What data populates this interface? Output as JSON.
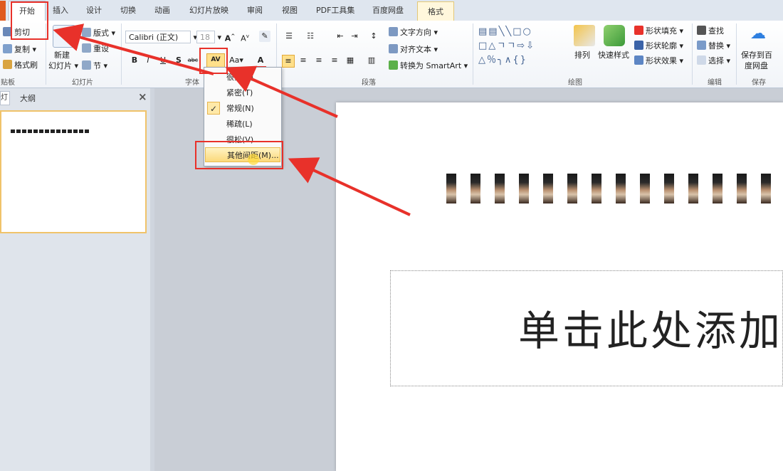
{
  "tabs": [
    "开始",
    "插入",
    "设计",
    "切换",
    "动画",
    "幻灯片放映",
    "审阅",
    "视图",
    "PDF工具集",
    "百度网盘",
    "格式"
  ],
  "clipboard": {
    "cut": "剪切",
    "copy": "复制",
    "format_painter": "格式刷",
    "label": "贴板"
  },
  "slides_group": {
    "new_slide_line1": "新建",
    "new_slide_line2": "幻灯片",
    "layout": "版式",
    "reset": "重设",
    "section": "节",
    "label": "幻灯片"
  },
  "font_group": {
    "font_name": "Calibri (正文)",
    "font_size": "18",
    "bold": "B",
    "italic": "I",
    "underline": "U",
    "strike": "abc",
    "shadow": "S",
    "spacing": "AV",
    "case": "Aa",
    "color": "A",
    "label": "字体"
  },
  "paragraph_group": {
    "text_direction": "文字方向",
    "align_text": "对齐文本",
    "smartart": "转换为 SmartArt",
    "label": "段落"
  },
  "drawing_group": {
    "arrange": "排列",
    "quick_styles": "快速样式",
    "fill": "形状填充",
    "outline": "形状轮廓",
    "effects": "形状效果",
    "label": "绘图"
  },
  "editing_group": {
    "find": "查找",
    "replace": "替换",
    "select": "选择",
    "label": "编辑"
  },
  "save_group": {
    "save_line1": "保存到百",
    "save_line2": "度网盘",
    "label": "保存"
  },
  "pane_tabs": {
    "slides": "灯",
    "outline": "大纲",
    "close": "×"
  },
  "spacing_menu": {
    "items": [
      "很紧(V)",
      "紧密(T)",
      "常规(N)",
      "稀疏(L)",
      "很松(V)",
      "其他间距(M)..."
    ],
    "checked_index": 2,
    "check_mark": "✓"
  },
  "slide": {
    "placeholder_text": "单击此处添加"
  },
  "colors": {
    "accent_red": "#e8312a",
    "highlight_yellow": "#fbd97a"
  }
}
